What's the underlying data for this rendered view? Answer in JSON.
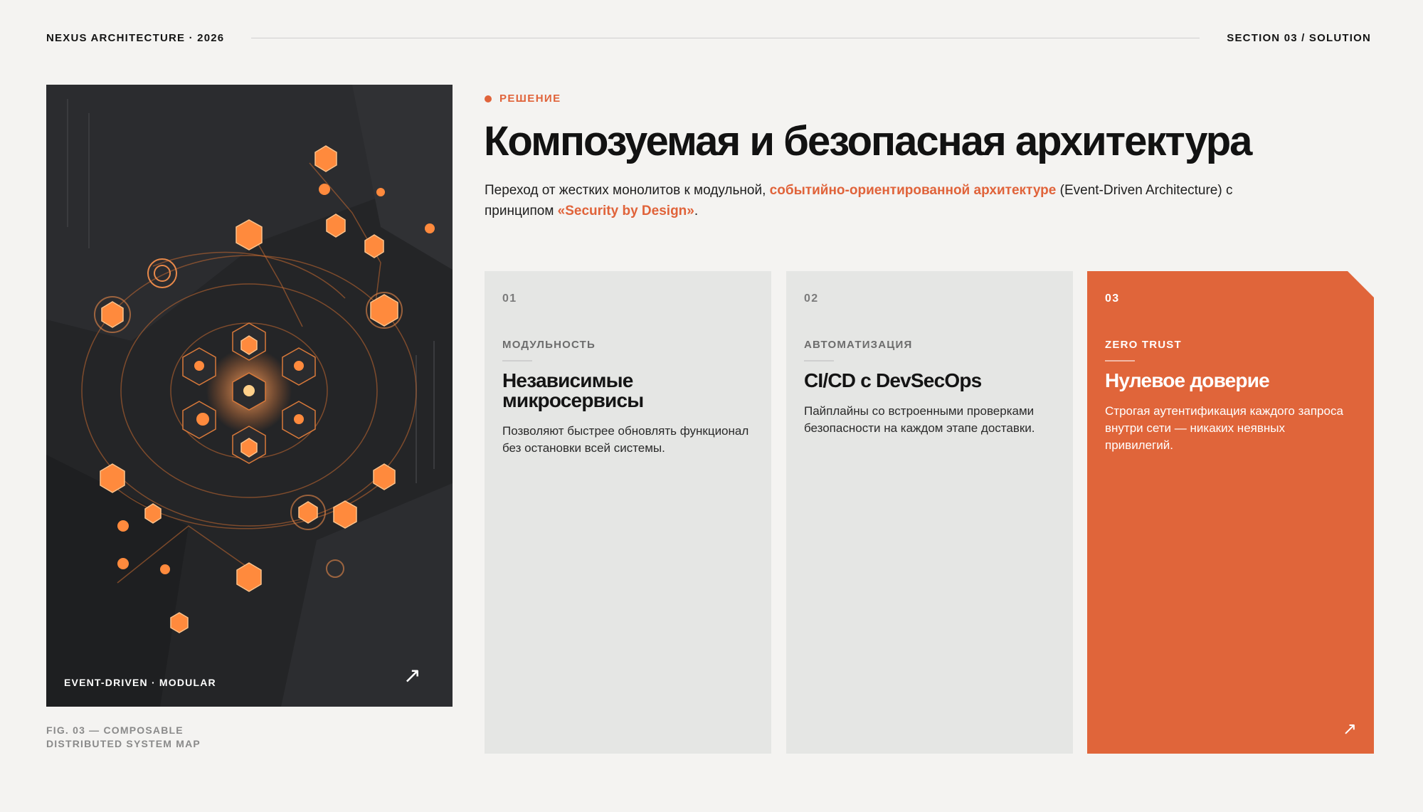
{
  "header": {
    "brand": "NEXUS ARCHITECTURE · 2026",
    "section": "SECTION 03 / SOLUTION"
  },
  "figure": {
    "label": "EVENT-DRIVEN · MODULAR",
    "arrow_icon": "arrow-up-right-icon",
    "caption_line1": "FIG. 03 — COMPOSABLE",
    "caption_line2": "DISTRIBUTED SYSTEM MAP"
  },
  "intro": {
    "kicker": "РЕШЕНИЕ",
    "title": "Композуемая и безопасная архитектура",
    "lead_part1": "Переход от жестких монолитов к модульной, ",
    "lead_highlight1": "событийно-ориентированной архитектуре",
    "lead_part2": " (Event-Driven Architecture) с принципом ",
    "lead_highlight2": "«Security by Design»",
    "lead_part3": "."
  },
  "cards": [
    {
      "num": "01",
      "tag": "МОДУЛЬНОСТЬ",
      "title": "Независимые микросервисы",
      "desc": "Позволяют быстрее обновлять функционал без остановки всей системы."
    },
    {
      "num": "02",
      "tag": "АВТОМАТИЗАЦИЯ",
      "title": "CI/CD с DevSecOps",
      "desc": "Пайплайны со встроенными проверками безопасности на каждом этапе доставки."
    },
    {
      "num": "03",
      "tag": "ZERO TRUST",
      "title": "Нулевое доверие",
      "desc": "Строгая аутентификация каждого запроса внутри сети — никаких неявных привилегий.",
      "arrow_icon": "arrow-up-right-icon"
    }
  ],
  "colors": {
    "accent": "#e0633a",
    "background": "#f4f3f1",
    "card": "#e5e6e4",
    "figure_bg": "#242527"
  }
}
